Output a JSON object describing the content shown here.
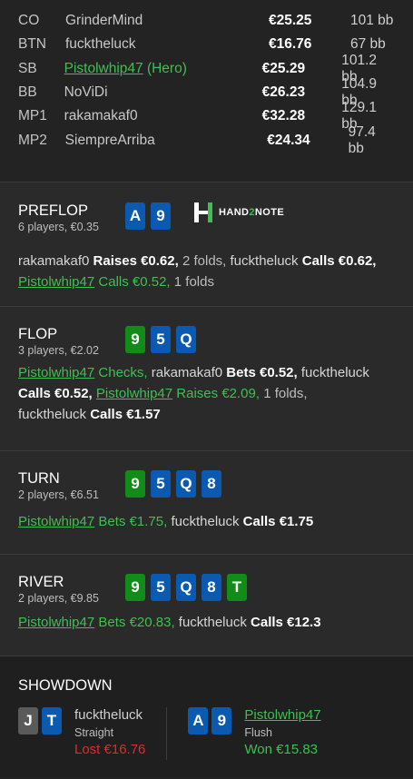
{
  "players": [
    {
      "pos": "CO",
      "name": "GrinderMind",
      "stack": "€25.25",
      "bb": "101 bb",
      "hero": false
    },
    {
      "pos": "BTN",
      "name": "fucktheluck",
      "stack": "€16.76",
      "bb": "67 bb",
      "hero": false
    },
    {
      "pos": "SB",
      "name": "Pistolwhip47",
      "hero_tag": "(Hero)",
      "stack": "€25.29",
      "bb": "101.2 bb",
      "hero": true
    },
    {
      "pos": "BB",
      "name": "NoViDi",
      "stack": "€26.23",
      "bb": "104.9 bb",
      "hero": false
    },
    {
      "pos": "MP1",
      "name": "rakamakaf0",
      "stack": "€32.28",
      "bb": "129.1 bb",
      "hero": false
    },
    {
      "pos": "MP2",
      "name": "SiempreArriba",
      "stack": "€24.34",
      "bb": "97.4 bb",
      "hero": false
    }
  ],
  "logo": {
    "text_a": "HAND",
    "text_b": "2",
    "text_c": "NOTE"
  },
  "preflop": {
    "name": "PREFLOP",
    "sub": "6 players, €0.35",
    "cards": [
      {
        "r": "A",
        "c": "blue"
      },
      {
        "r": "9",
        "c": "blue"
      }
    ],
    "a1_name": "rakamakaf0",
    "a1_act": "Raises €0.62,",
    "a1_folds": "2 folds,",
    "a2_name": "fucktheluck",
    "a2_act": "Calls €0.62,",
    "a3_name": "Pistolwhip47",
    "a3_act": "Calls €0.52,",
    "a3_folds": "1 folds"
  },
  "flop": {
    "name": "FLOP",
    "sub": "3 players, €2.02",
    "cards": [
      {
        "r": "9",
        "c": "green"
      },
      {
        "r": "5",
        "c": "blue"
      },
      {
        "r": "Q",
        "c": "blue"
      }
    ],
    "a1_name": "Pistolwhip47",
    "a1_act": "Checks,",
    "a2_name": "rakamakaf0",
    "a2_act": "Bets €0.52,",
    "a3_name": "fucktheluck",
    "a3_act": "Calls €0.52,",
    "a4_name": "Pistolwhip47",
    "a4_act": "Raises €2.09,",
    "a4_folds": "1 folds,",
    "a5_name": "fucktheluck",
    "a5_act": "Calls €1.57"
  },
  "turn": {
    "name": "TURN",
    "sub": "2 players, €6.51",
    "cards": [
      {
        "r": "9",
        "c": "green"
      },
      {
        "r": "5",
        "c": "blue"
      },
      {
        "r": "Q",
        "c": "blue"
      },
      {
        "r": "8",
        "c": "blue"
      }
    ],
    "a1_name": "Pistolwhip47",
    "a1_act": "Bets €1.75,",
    "a2_name": "fucktheluck",
    "a2_act": "Calls €1.75"
  },
  "river": {
    "name": "RIVER",
    "sub": "2 players, €9.85",
    "cards": [
      {
        "r": "9",
        "c": "green"
      },
      {
        "r": "5",
        "c": "blue"
      },
      {
        "r": "Q",
        "c": "blue"
      },
      {
        "r": "8",
        "c": "blue"
      },
      {
        "r": "T",
        "c": "green"
      }
    ],
    "a1_name": "Pistolwhip47",
    "a1_act": "Bets €20.83,",
    "a2_name": "fucktheluck",
    "a2_act": "Calls €12.3"
  },
  "showdown": {
    "title": "SHOWDOWN",
    "villain": {
      "name": "fucktheluck",
      "hand": "Straight",
      "result": "Lost €16.76",
      "cards": [
        {
          "r": "J",
          "c": "gray"
        },
        {
          "r": "T",
          "c": "blue"
        }
      ]
    },
    "hero": {
      "name": "Pistolwhip47",
      "hand": "Flush",
      "result": "Won €15.83",
      "cards": [
        {
          "r": "A",
          "c": "blue"
        },
        {
          "r": "9",
          "c": "blue"
        }
      ]
    }
  },
  "colors": {
    "hero_green": "#3fbf52",
    "card_blue": "#0b5ab2",
    "card_green": "#118c18",
    "card_gray": "#5a5a5a",
    "lost_red": "#e02b2b"
  }
}
